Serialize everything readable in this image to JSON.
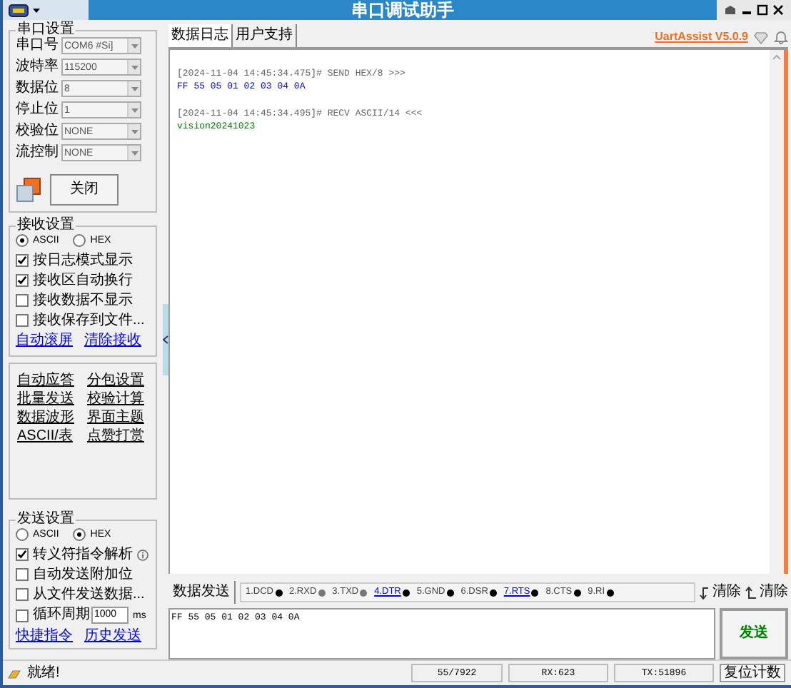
{
  "window": {
    "title": "串口调试助手"
  },
  "serial_settings": {
    "title": "串口设置",
    "fields": [
      {
        "label": "串口号",
        "value": "COM6 #Si]"
      },
      {
        "label": "波特率",
        "value": "115200"
      },
      {
        "label": "数据位",
        "value": "8"
      },
      {
        "label": "停止位",
        "value": "1"
      },
      {
        "label": "校验位",
        "value": "NONE"
      },
      {
        "label": "流控制",
        "value": "NONE"
      }
    ],
    "close_button": "关闭"
  },
  "receive_settings": {
    "title": "接收设置",
    "modes": [
      {
        "label": "ASCII",
        "selected": true
      },
      {
        "label": "HEX",
        "selected": false
      }
    ],
    "options": [
      {
        "label": "按日志模式显示",
        "checked": true
      },
      {
        "label": "接收区自动换行",
        "checked": true
      },
      {
        "label": "接收数据不显示",
        "checked": false
      },
      {
        "label": "接收保存到文件...",
        "checked": false
      }
    ],
    "links": [
      "自动滚屏",
      "清除接收"
    ]
  },
  "tools": [
    "自动应答",
    "分包设置",
    "批量发送",
    "校验计算",
    "数据波形",
    "界面主题",
    "ASCII/表",
    "点赞打赏"
  ],
  "send_settings": {
    "title": "发送设置",
    "modes": [
      {
        "label": "ASCII",
        "selected": false
      },
      {
        "label": "HEX",
        "selected": true
      }
    ],
    "options": [
      {
        "label": "转义符指令解析",
        "checked": true,
        "info": true
      },
      {
        "label": "自动发送附加位",
        "checked": false,
        "info": false
      },
      {
        "label": "从文件发送数据...",
        "checked": false,
        "info": false
      }
    ],
    "cycle": {
      "label": "循环周期",
      "checked": false,
      "value": "1000",
      "unit": "ms"
    },
    "links": [
      "快捷指令",
      "历史发送"
    ]
  },
  "tabs": [
    {
      "label": "数据日志",
      "selected": true
    },
    {
      "label": "用户支持",
      "selected": false
    }
  ],
  "version_link": "UartAssist V5.0.9",
  "log": [
    {
      "kind": "header",
      "text": "[2024-11-04 14:45:34.475]# SEND HEX/8 >>>"
    },
    {
      "kind": "sent",
      "text": "FF 55 05 01 02 03 04 0A"
    },
    {
      "kind": "header",
      "text": "[2024-11-04 14:45:34.495]# RECV ASCII/14 <<<"
    },
    {
      "kind": "received",
      "text": "vision20241023"
    }
  ],
  "send_panel": {
    "tab": "数据发送",
    "signals": [
      {
        "label": "1.DCD",
        "link": false,
        "on": true
      },
      {
        "label": "2.RXD",
        "link": false,
        "on": false
      },
      {
        "label": "3.TXD",
        "link": false,
        "on": false
      },
      {
        "label": "4.DTR",
        "link": true,
        "on": true
      },
      {
        "label": "5.GND",
        "link": false,
        "on": true
      },
      {
        "label": "6.DSR",
        "link": false,
        "on": true
      },
      {
        "label": "7.RTS",
        "link": true,
        "on": true
      },
      {
        "label": "8.CTS",
        "link": false,
        "on": true
      },
      {
        "label": "9.RI",
        "link": false,
        "on": true
      }
    ],
    "clear_buttons": [
      "清除",
      "清除"
    ],
    "input": "FF 55 05 01 02 03 04 0A",
    "send_button": "发送"
  },
  "status_bar": {
    "message": "就绪!",
    "counts": [
      "55/7922",
      "RX:623",
      "TX:51896"
    ],
    "reset_button": "复位计数"
  }
}
